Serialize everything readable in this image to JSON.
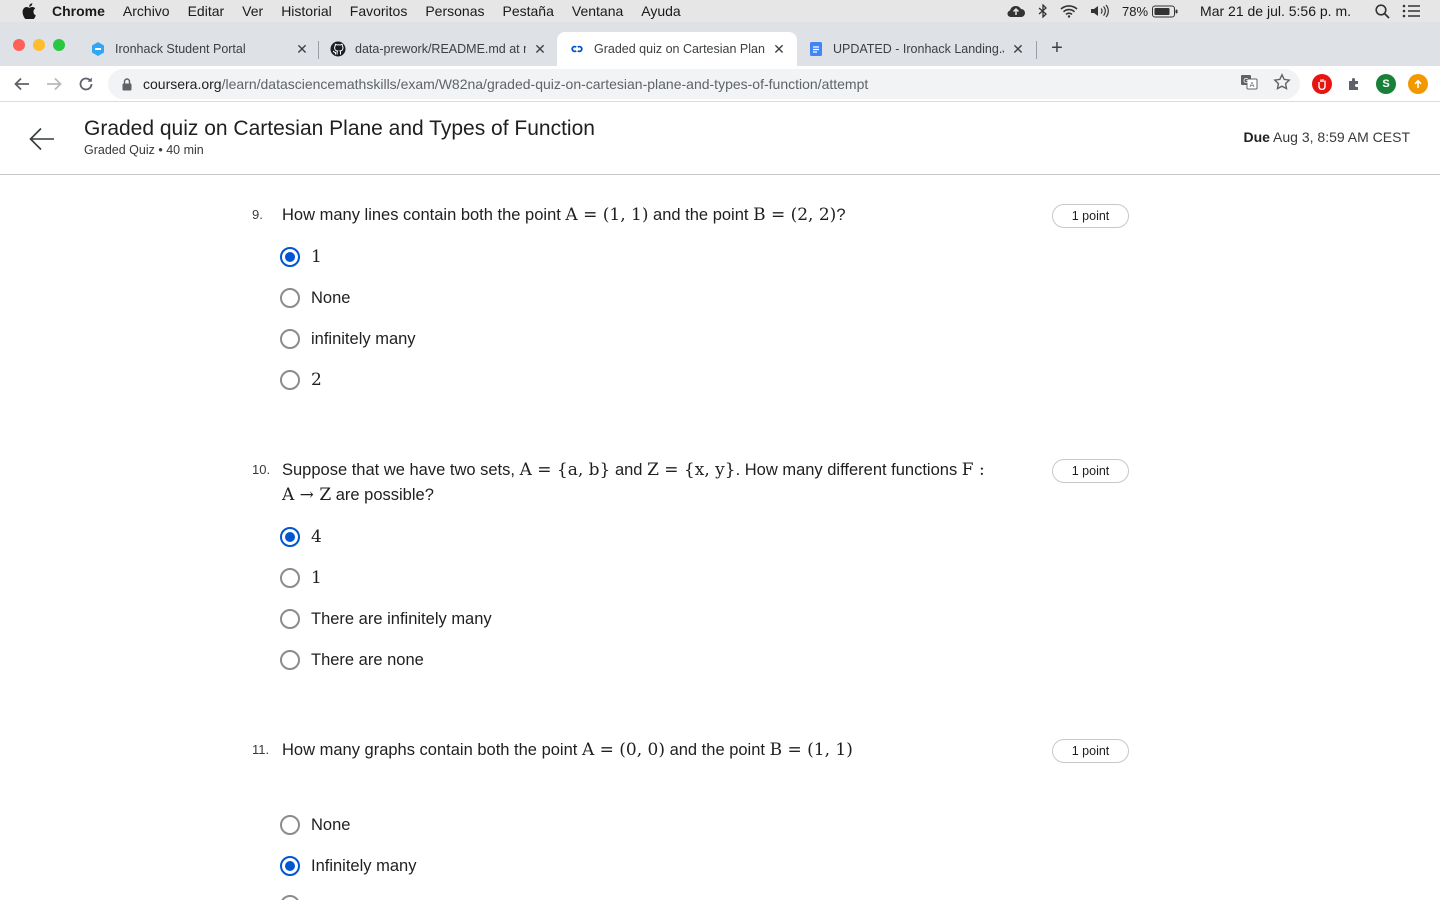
{
  "menubar": {
    "app": "Chrome",
    "items": [
      "Archivo",
      "Editar",
      "Ver",
      "Historial",
      "Favoritos",
      "Personas",
      "Pestaña",
      "Ventana",
      "Ayuda"
    ],
    "battery": "78%",
    "clock": "Mar 21 de jul.  5:56 p. m."
  },
  "tabs": [
    {
      "title": "Ironhack Student Portal",
      "icon": "ironhack-icon"
    },
    {
      "title": "data-prework/README.md at m",
      "icon": "github-icon"
    },
    {
      "title": "Graded quiz on Cartesian Plane",
      "icon": "coursera-icon"
    },
    {
      "title": "UPDATED - Ironhack Landing.Ju",
      "icon": "google-docs-icon"
    }
  ],
  "address": {
    "host": "coursera.org",
    "path": "/learn/datasciencemathskills/exam/W82na/graded-quiz-on-cartesian-plane-and-types-of-function/attempt"
  },
  "extensions": {
    "profile_letter": "S"
  },
  "header": {
    "title": "Graded quiz on Cartesian Plane and Types of Function",
    "subtitle": "Graded Quiz • 40 min",
    "due_label": "Due",
    "due_value": " Aug 3, 8:59 AM CEST"
  },
  "questions": [
    {
      "number": "9.",
      "text_parts": [
        "How many lines contain both the point ",
        "A = (1, 1)",
        " and the point ",
        "B = (2, 2)",
        "?"
      ],
      "points": "1 point",
      "options": [
        {
          "label": "1",
          "selected": true
        },
        {
          "label": "None",
          "selected": false
        },
        {
          "label": "infinitely many",
          "selected": false
        },
        {
          "label": "2",
          "selected": false
        }
      ]
    },
    {
      "number": "10.",
      "text_parts": [
        "Suppose that we have two sets, ",
        "A = {a, b}",
        " and ",
        "Z = {x, y}",
        ". How many different functions ",
        "F :",
        "A → Z",
        " are possible?"
      ],
      "points": "1 point",
      "options": [
        {
          "label": "4",
          "selected": true
        },
        {
          "label": "1",
          "selected": false
        },
        {
          "label": "There are infinitely many",
          "selected": false
        },
        {
          "label": "There are none",
          "selected": false
        }
      ]
    },
    {
      "number": "11.",
      "text_parts": [
        "How many graphs contain both the point ",
        "A = (0, 0)",
        " and the point ",
        "B = (1, 1)"
      ],
      "points": "1 point",
      "options": [
        {
          "label": "None",
          "selected": false
        },
        {
          "label": "Infinitely many",
          "selected": true
        }
      ]
    }
  ],
  "colors": {
    "accent": "#0056d2",
    "tabstrip": "#dee1e6",
    "omnibox": "#f1f3f4",
    "menubar": "#e6e6e6"
  }
}
